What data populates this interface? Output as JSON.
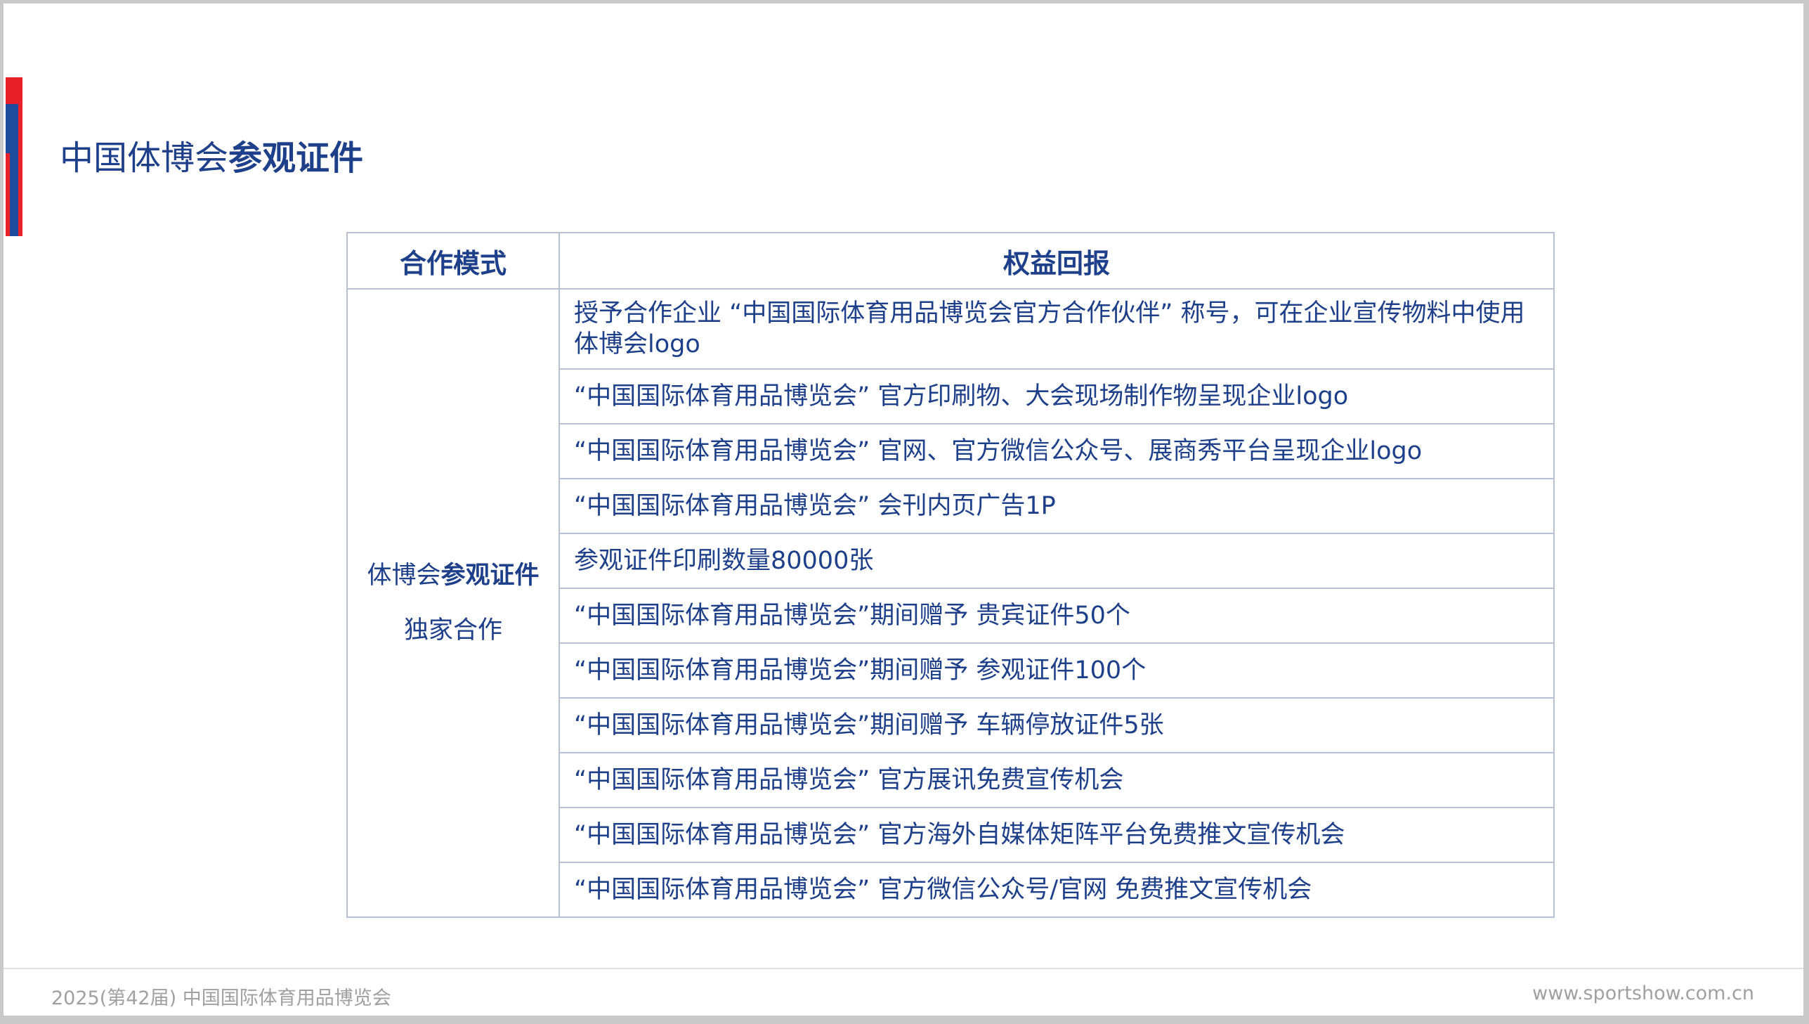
{
  "title": {
    "normal": "中国体博会",
    "bold": "参观证件"
  },
  "table": {
    "headers": [
      "合作模式",
      "权益回报"
    ],
    "mode": {
      "line1_normal": "体博会",
      "line1_bold": "参观证件",
      "line2": "独家合作"
    },
    "rows": [
      "授予合作企业 “中国国际体育用品博览会官方合作伙伴” 称号，可在企业宣传物料中使用体博会logo",
      "“中国国际体育用品博览会” 官方印刷物、大会现场制作物呈现企业logo",
      "“中国国际体育用品博览会” 官网、官方微信公众号、展商秀平台呈现企业logo",
      "“中国国际体育用品博览会” 会刊内页广告1P",
      " 参观证件印刷数量80000张",
      "“中国国际体育用品博览会”期间赠予 贵宾证件50个",
      "“中国国际体育用品博览会”期间赠予 参观证件100个",
      "“中国国际体育用品博览会”期间赠予 车辆停放证件5张",
      "“中国国际体育用品博览会” 官方展讯免费宣传机会",
      "“中国国际体育用品博览会” 官方海外自媒体矩阵平台免费推文宣传机会",
      "“中国国际体育用品博览会” 官方微信公众号/官网 免费推文宣传机会"
    ]
  },
  "footer": {
    "left": "2025(第42届) 中国国际体育用品博览会",
    "right": "www.sportshow.com.cn"
  },
  "colors": {
    "brand_blue": "#1e3f8a",
    "accent_red": "#e8202a",
    "grid": "#b7c1d3"
  }
}
